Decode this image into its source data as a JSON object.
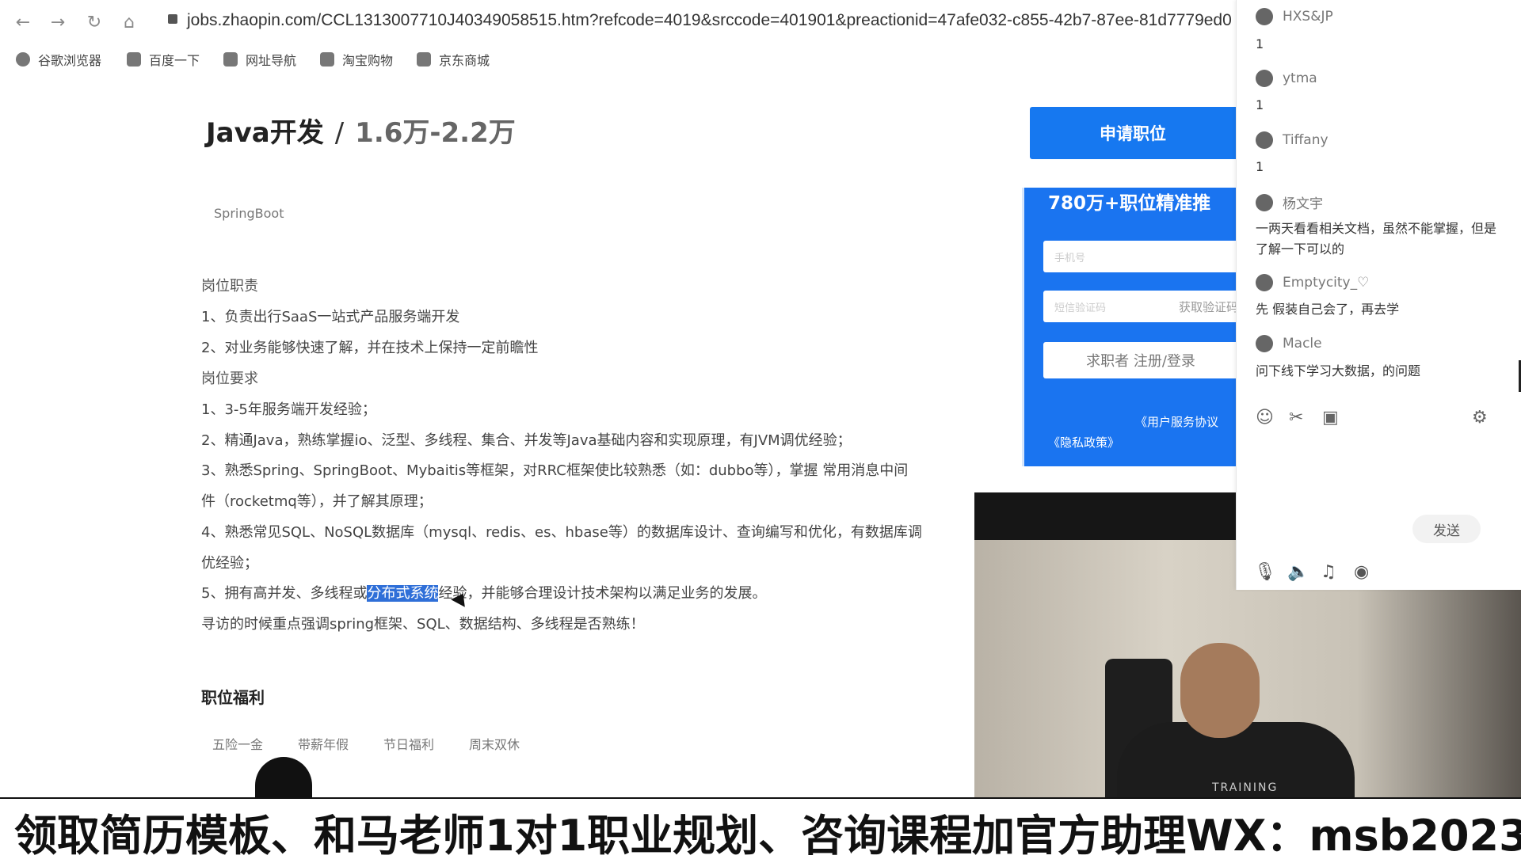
{
  "browser": {
    "url": "jobs.zhaopin.com/CCL1313007710J40349058515.htm?refcode=4019&srccode=401901&preactionid=47afe032-c855-42b7-87ee-81d7779ed0",
    "bookmarks": [
      "谷歌浏览器",
      "百度一下",
      "网址导航",
      "淘宝购物",
      "京东商城"
    ]
  },
  "job": {
    "title": "Java开发",
    "separator": "/",
    "salary": "1.6万-2.2万",
    "skill_tag": "SpringBoot",
    "duties_heading": "岗位职责",
    "duties": [
      "1、负责出行SaaS一站式产品服务端开发",
      "2、对业务能够快速了解，并在技术上保持一定前瞻性"
    ],
    "requirements_heading": "岗位要求",
    "requirements": [
      "1、3-5年服务端开发经验；",
      "2、精通Java，熟练掌握io、泛型、多线程、集合、并发等Java基础内容和实现原理，有JVM调优经验；",
      "3、熟悉Spring、SpringBoot、Mybaitis等框架，对RRC框架使比较熟悉（如：dubbo等），掌握 常用消息中间",
      "件（rocketmq等），并了解其原理；",
      "4、熟悉常见SQL、NoSQL数据库（mysql、redis、es、hbase等）的数据库设计、查询编写和优化，有数据库调",
      "优经验；"
    ],
    "req5_before": "5、拥有高并发、多线程或",
    "req5_highlight": "分布式系统",
    "req5_after": "经验，并能够合理设计技术架构以满足业务的发展。",
    "interview_note": "寻访的时候重点强调spring框架、SQL、数据结构、多线程是否熟练！",
    "benefits_heading": "职位福利",
    "benefits": [
      "五险一金",
      "带薪年假",
      "节日福利",
      "周末双休"
    ]
  },
  "side_card": {
    "apply_label": "申请职位",
    "headline": "780万+职位精准推",
    "phone_placeholder": "手机号",
    "code_placeholder": "短信验证码",
    "get_code": "获取验证码",
    "submit_label": "求职者 注册/登录",
    "terms_line1": "《用户服务协议",
    "terms_line2": "《隐私政策》"
  },
  "chat": {
    "messages": [
      {
        "user": "HXS&JP",
        "text": "1"
      },
      {
        "user": "ytma",
        "text": "1"
      },
      {
        "user": "Tiffany",
        "text": "1"
      },
      {
        "user": "杨文宇",
        "text": "一两天看看相关文档，虽然不能掌握，但是了解一下可以的"
      },
      {
        "user": "Emptycity_♡",
        "text": "先 假装自己会了，再去学"
      },
      {
        "user": "Macle",
        "text": "问下线下学习大数据，的问题"
      }
    ],
    "send_label": "发送",
    "tool_icons": [
      "smile-icon",
      "scissors-icon",
      "image-icon",
      "settings-icon"
    ],
    "bottom_icons": [
      "microphone-icon",
      "speaker-icon",
      "music-icon",
      "location-icon"
    ]
  },
  "webcam": {
    "shirt_text": "TRAINING"
  },
  "banner": {
    "text": "领取简历模板、和马老师1对1职业规划、咨询课程加官方助理WX：msb2023"
  },
  "colors": {
    "brand_blue": "#1678f0",
    "highlight": "#2f6fd8"
  }
}
